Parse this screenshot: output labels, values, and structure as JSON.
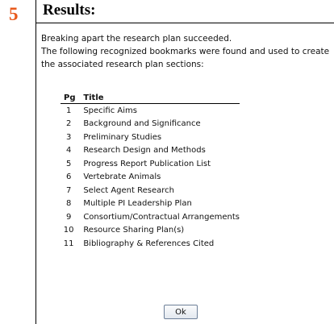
{
  "step": {
    "number": "5"
  },
  "panel": {
    "title": "Results:",
    "message_line1": "Breaking apart the research plan succeeded.",
    "message_line2": "The following recognized bookmarks were found and used to create the associated research plan sections:"
  },
  "table": {
    "headers": {
      "pg": "Pg",
      "title": "Title"
    },
    "rows": [
      {
        "pg": "1",
        "title": "Specific Aims"
      },
      {
        "pg": "2",
        "title": "Background and Significance"
      },
      {
        "pg": "3",
        "title": "Preliminary Studies"
      },
      {
        "pg": "4",
        "title": "Research Design and Methods"
      },
      {
        "pg": "5",
        "title": "Progress Report Publication List"
      },
      {
        "pg": "6",
        "title": "Vertebrate Animals"
      },
      {
        "pg": "7",
        "title": "Select Agent Research"
      },
      {
        "pg": "8",
        "title": "Multiple PI Leadership Plan"
      },
      {
        "pg": "9",
        "title": "Consortium/Contractual Arrangements"
      },
      {
        "pg": "10",
        "title": "Resource Sharing Plan(s)"
      },
      {
        "pg": "11",
        "title": "Bibliography & References Cited"
      }
    ]
  },
  "buttons": {
    "ok_label": "Ok"
  },
  "colors": {
    "step_number": "#e8581a",
    "text": "#111111",
    "rule": "#000000"
  }
}
